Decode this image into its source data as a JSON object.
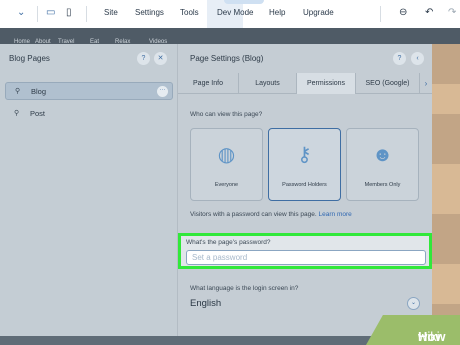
{
  "topbar": {
    "menu": [
      "Site",
      "Settings",
      "Tools",
      "Dev Mode",
      "Help",
      "Upgrade"
    ]
  },
  "subbar": {
    "items": [
      "Home",
      "About",
      "Travel",
      "Eat",
      "Relax",
      "Videos"
    ]
  },
  "left_panel": {
    "title": "Blog Pages",
    "help_label": "?",
    "close_label": "✕",
    "pages": [
      {
        "label": "Blog",
        "more": "···"
      },
      {
        "label": "Post"
      }
    ]
  },
  "right_panel": {
    "title": "Page Settings (Blog)",
    "help_label": "?",
    "back_label": "‹",
    "tabs": [
      "Page Info",
      "Layouts",
      "Permissions",
      "SEO (Google)"
    ],
    "tab_arrow": "›",
    "who_label": "Who can view this page?",
    "options": [
      {
        "label": "Everyone",
        "icon": "globe-icon"
      },
      {
        "label": "Password Holders",
        "icon": "key-icon"
      },
      {
        "label": "Members Only",
        "icon": "members-icon"
      }
    ],
    "info_text": "Visitors with a password can view this page.",
    "info_link": "Learn more",
    "password_label": "What's the page's password?",
    "password_placeholder": "Set a password",
    "language_label": "What language is the login screen in?",
    "language_value": "English",
    "language_chevron": "⌄"
  },
  "watermark": {
    "wiki": "wiki",
    "how": "How"
  },
  "colors": {
    "highlight": "#31e83a",
    "accent": "#3f6ea3",
    "link": "#2f67b1"
  }
}
